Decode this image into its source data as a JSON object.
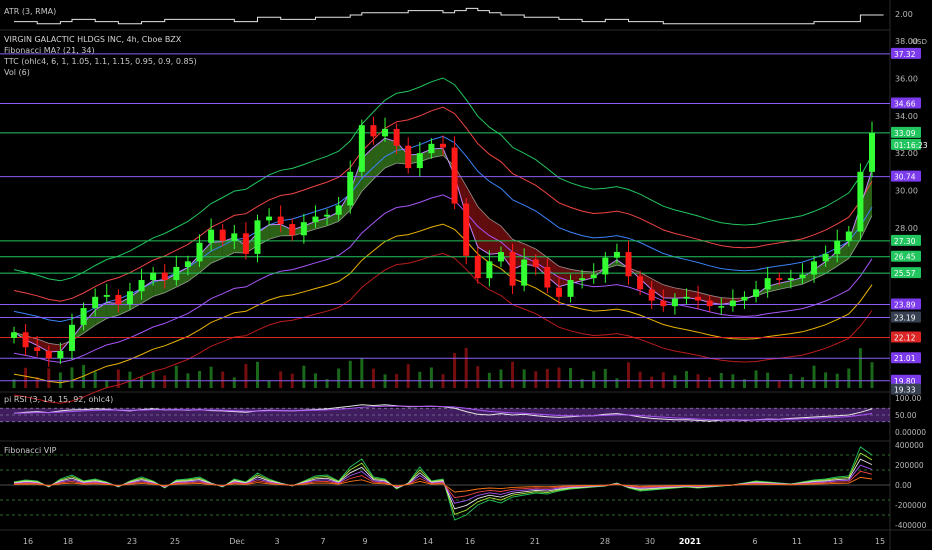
{
  "colors": {
    "background": "#000000",
    "up": "#33ff33",
    "down": "#ff1a1a",
    "fill_up": "#2f6b1a",
    "fill_down": "#6b0e0e",
    "fib_line": "#8b5cf6",
    "green_line": "#22c55e",
    "rsi_fill": "#5b2a86"
  },
  "panels": {
    "atr": {
      "label": "ATR (3, RMA)",
      "tick": "2.00"
    },
    "main": {
      "title": "VIRGIN GALACTIC HLDGS INC, 4h, Cboe BZX",
      "indicators": [
        "Fibonacci MA? (21, 34)",
        "TTC (ohlc4, 6, 1, 1.05, 1.1, 1.15, 0.95, 0.9, 0.85)",
        "Vol (6)"
      ],
      "currency": "USD",
      "axis_ticks": [
        "38.00",
        "36.00",
        "34.00",
        "32.00",
        "30.00",
        "28.00"
      ],
      "badges": [
        {
          "text": "37.32",
          "color": "#7c3aed"
        },
        {
          "text": "34.66",
          "color": "#7c3aed"
        },
        {
          "text": "33.09",
          "color": "#22c55e"
        },
        {
          "text": "01:16:23",
          "color": "#22c55e"
        },
        {
          "text": "30.74",
          "color": "#7c3aed"
        },
        {
          "text": "27.30",
          "color": "#22c55e"
        },
        {
          "text": "26.45",
          "color": "#22c55e"
        },
        {
          "text": "25.57",
          "color": "#22c55e"
        },
        {
          "text": "23.89",
          "color": "#7c3aed"
        },
        {
          "text": "23.19",
          "color": "#374151"
        },
        {
          "text": "22.12",
          "color": "#dc2626"
        },
        {
          "text": "21.01",
          "color": "#7c3aed"
        },
        {
          "text": "19.80",
          "color": "#7c3aed"
        },
        {
          "text": "19.33",
          "color": "#374151"
        }
      ]
    },
    "rsi": {
      "label": "pi RSI (3, 14, 15, 92, ohlc4)",
      "ticks": [
        "100.00",
        "50.00",
        "0.00000"
      ]
    },
    "vip": {
      "label": "Fibonacci VIP",
      "ticks": [
        "400000",
        "200000",
        "0.00",
        "-200000",
        "-400000"
      ]
    }
  },
  "x_axis": [
    "16",
    "18",
    "23",
    "25",
    "Dec",
    "3",
    "7",
    "9",
    "14",
    "16",
    "21",
    "28",
    "30",
    "2021",
    "6",
    "11",
    "13",
    "15"
  ],
  "chart_data": {
    "type": "candlestick",
    "title": "VIRGIN GALACTIC HLDGS INC, 4h, Cboe BZX",
    "y_unit": "USD",
    "ylim": [
      19.2,
      38.6
    ],
    "x_tick_labels": [
      "16",
      "18",
      "23",
      "25",
      "Dec",
      "3",
      "7",
      "9",
      "14",
      "16",
      "21",
      "28",
      "30",
      "2021",
      "6",
      "11",
      "13",
      "15"
    ],
    "last_price": 33.09,
    "countdown": "01:16:23",
    "close_series": [
      22.4,
      21.6,
      21.4,
      21.0,
      21.4,
      22.8,
      23.7,
      24.3,
      24.4,
      23.9,
      24.6,
      25.2,
      25.6,
      25.2,
      25.9,
      26.2,
      27.2,
      27.9,
      27.3,
      27.7,
      26.6,
      28.4,
      28.6,
      28.2,
      27.6,
      28.3,
      28.6,
      28.7,
      29.2,
      31.0,
      33.5,
      32.9,
      33.3,
      32.4,
      31.2,
      32.0,
      32.5,
      32.3,
      29.3,
      26.5,
      25.3,
      26.2,
      26.7,
      24.9,
      26.3,
      25.9,
      24.8,
      24.3,
      25.2,
      25.3,
      25.5,
      26.4,
      26.7,
      25.4,
      24.7,
      24.1,
      23.8,
      24.2,
      24.3,
      24.1,
      23.8,
      23.8,
      24.1,
      24.3,
      24.7,
      25.3,
      25.2,
      25.3,
      25.5,
      26.2,
      26.6,
      27.3,
      27.8,
      31.0,
      33.09
    ],
    "horizontal_levels": [
      37.32,
      34.66,
      33.09,
      30.74,
      27.3,
      26.45,
      25.57,
      23.89,
      23.19,
      22.12,
      21.01,
      19.8
    ],
    "atr_series": [
      2.0,
      2.0,
      1.9,
      1.9,
      2.0,
      2.1,
      2.1,
      2.0,
      2.0,
      1.9,
      1.9,
      2.0,
      2.0,
      2.1,
      2.1,
      2.1,
      2.1,
      2.1,
      2.1,
      2.0,
      2.0,
      2.2,
      2.2,
      2.1,
      2.1,
      2.1,
      2.2,
      2.2,
      2.2,
      2.3,
      2.4,
      2.4,
      2.4,
      2.4,
      2.5,
      2.5,
      2.5,
      2.4,
      2.5,
      2.6,
      2.5,
      2.4,
      2.3,
      2.3,
      2.2,
      2.2,
      2.2,
      2.1,
      2.1,
      2.0,
      2.0,
      2.1,
      2.1,
      2.0,
      2.0,
      2.0,
      1.9,
      1.9,
      1.9,
      1.9,
      1.9,
      1.9,
      1.9,
      1.9,
      1.9,
      1.9,
      1.9,
      1.9,
      1.9,
      2.0,
      2.0,
      2.0,
      2.0,
      2.3,
      2.3
    ],
    "rsi_series": [
      55,
      58,
      60,
      57,
      62,
      65,
      66,
      68,
      67,
      64,
      62,
      66,
      68,
      65,
      66,
      64,
      66,
      63,
      62,
      60,
      58,
      62,
      64,
      63,
      62,
      64,
      66,
      68,
      72,
      76,
      80,
      78,
      80,
      77,
      74,
      75,
      76,
      74,
      70,
      60,
      52,
      50,
      54,
      50,
      52,
      48,
      45,
      43,
      45,
      47,
      48,
      52,
      54,
      50,
      44,
      40,
      38,
      36,
      36,
      34,
      32,
      35,
      36,
      34,
      36,
      38,
      37,
      40,
      42,
      44,
      46,
      48,
      50,
      58,
      68
    ],
    "vip_series": [
      30,
      50,
      40,
      -20,
      60,
      100,
      40,
      60,
      30,
      -20,
      40,
      80,
      40,
      -30,
      50,
      60,
      80,
      20,
      -20,
      60,
      30,
      120,
      60,
      20,
      -10,
      40,
      90,
      100,
      40,
      180,
      260,
      80,
      60,
      -40,
      20,
      180,
      40,
      60,
      -350,
      -300,
      -200,
      -150,
      -180,
      -120,
      -100,
      -80,
      -90,
      -60,
      -40,
      -30,
      -20,
      -10,
      20,
      -30,
      -60,
      -50,
      -40,
      -30,
      -20,
      -30,
      -20,
      -10,
      0,
      20,
      40,
      30,
      20,
      10,
      30,
      50,
      60,
      80,
      90,
      380,
      300
    ]
  }
}
